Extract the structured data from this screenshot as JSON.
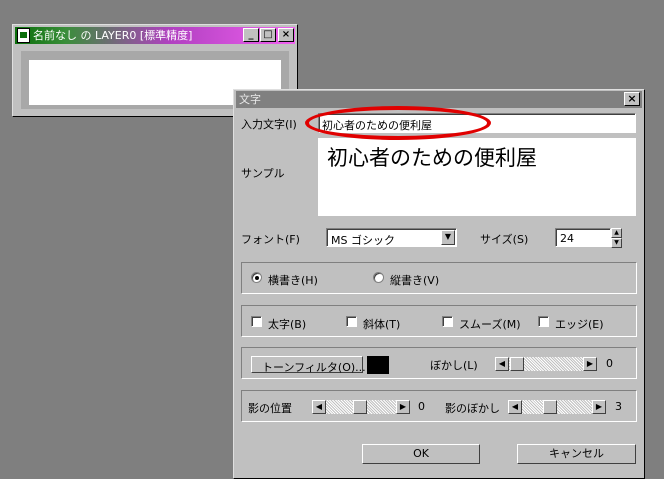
{
  "colors": {
    "desktop": "#7f7f7f",
    "highlight": "#e00000",
    "tone_swatch": "#000000"
  },
  "layer_window": {
    "title": "名前なし の LAYER0 [標準精度]",
    "minimize": "_",
    "maximize": "□",
    "close": "×"
  },
  "dialog": {
    "title": "文字",
    "close": "×",
    "input_label": "入力文字(I)",
    "input_value": "初心者のための便利屋",
    "sample_label": "サンプル",
    "sample_text": "初心者のための便利屋",
    "font_label": "フォント(F)",
    "font_value": "MS ゴシック",
    "size_label": "サイズ(S)",
    "size_value": "24",
    "orientation": {
      "horizontal": "横書き(H)",
      "vertical": "縦書き(V)",
      "selected": "horizontal"
    },
    "styles": {
      "bold": "太字(B)",
      "italic": "斜体(T)",
      "smooth": "スムーズ(M)",
      "edge": "エッジ(E)"
    },
    "tone_filter_label": "トーンフィルタ(O)...",
    "blur_label": "ぼかし(L)",
    "blur_value": "0",
    "shadow_pos_label": "影の位置",
    "shadow_pos_value": "0",
    "shadow_blur_label": "影のぼかし",
    "shadow_blur_value": "3",
    "ok_label": "OK",
    "cancel_label": "キャンセル",
    "icons": {
      "left": "left-arrow-icon",
      "right": "right-arrow-icon",
      "dropdown": "dropdown-arrow-icon"
    }
  }
}
